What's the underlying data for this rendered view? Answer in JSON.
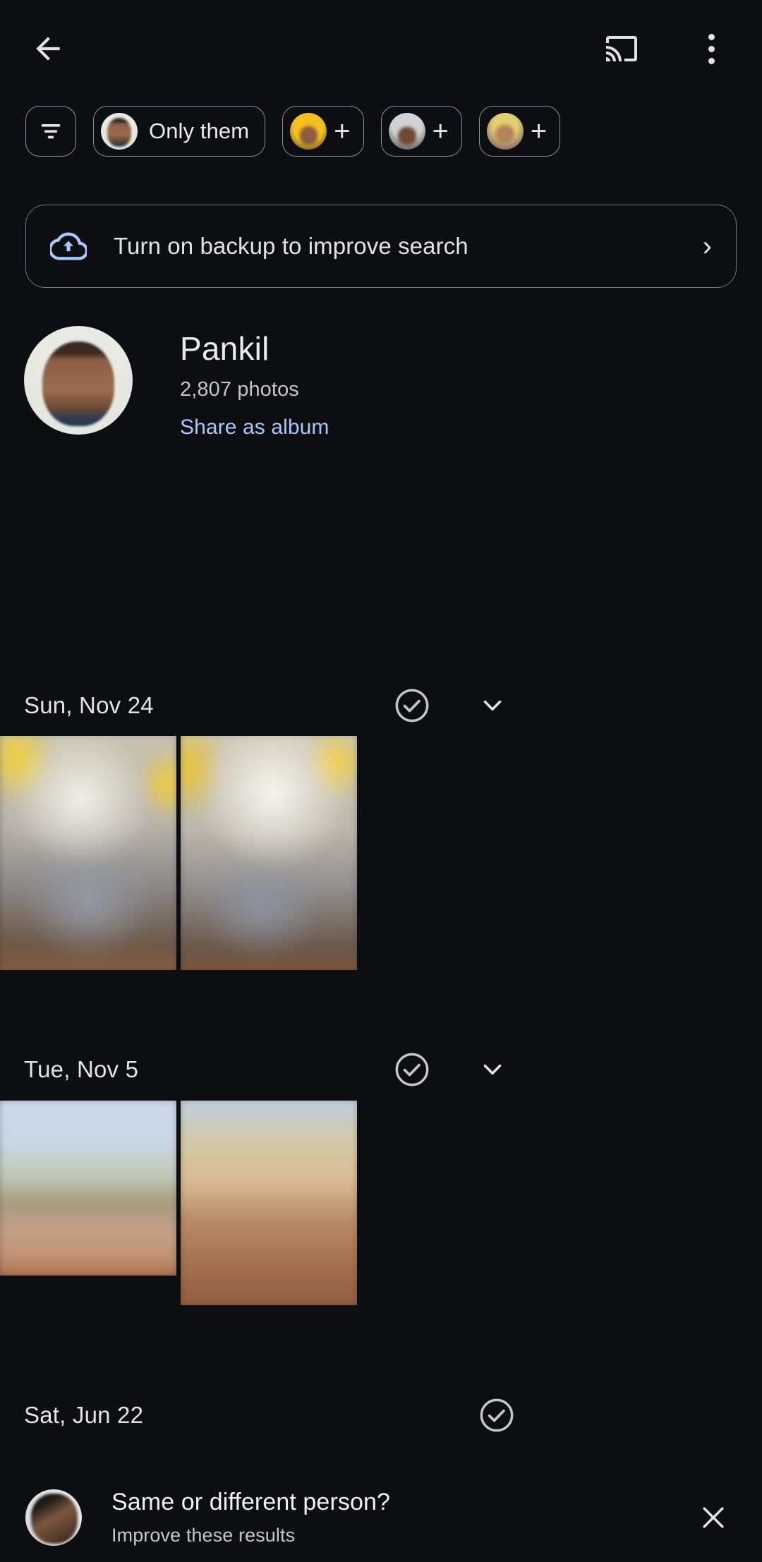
{
  "app": {
    "background_color": "#0d0e11",
    "accent_link_color": "#a8c7fa",
    "border_color": "#75777f"
  },
  "appbar": {
    "back_icon": "arrow-back-icon",
    "cast_icon": "cast-icon",
    "overflow_icon": "more-vert-icon"
  },
  "chips": [
    {
      "type": "filter",
      "icon": "filter-icon",
      "label": ""
    },
    {
      "type": "person",
      "icon": "avatar",
      "label": "Only them",
      "avatar_style": "face-a"
    },
    {
      "type": "add",
      "icon": "plus-icon",
      "label": "+",
      "avatar_style": "face-b"
    },
    {
      "type": "add",
      "icon": "plus-icon",
      "label": "+",
      "avatar_style": "face-c"
    },
    {
      "type": "add",
      "icon": "plus-icon",
      "label": "+",
      "avatar_style": "face-d"
    }
  ],
  "backup_banner": {
    "icon": "cloud-upload-icon",
    "text": "Turn on backup to improve search",
    "chevron": "chevron-right-icon"
  },
  "person": {
    "name": "Pankil",
    "photo_count": "2,807 photos",
    "share_label": "Share as album",
    "avatar": "person-avatar"
  },
  "sections": [
    {
      "date": "Sun, Nov 24",
      "select_icon": "check-circle-icon",
      "expand_icon": "chevron-down-icon",
      "photos": [
        "party-photo-1",
        "party-photo-2"
      ]
    },
    {
      "date": "Tue, Nov 5",
      "select_icon": "check-circle-icon",
      "expand_icon": "chevron-down-icon",
      "photos": [
        "outdoor-photo-1",
        "outdoor-photo-2"
      ]
    },
    {
      "date": "Sat, Jun 22",
      "select_icon": "check-circle-icon",
      "expand_icon": "",
      "photos": []
    }
  ],
  "bottom_banner": {
    "title": "Same or different person?",
    "subtitle": "Improve these results",
    "close_icon": "close-icon",
    "avatar": "suggestion-avatar"
  }
}
